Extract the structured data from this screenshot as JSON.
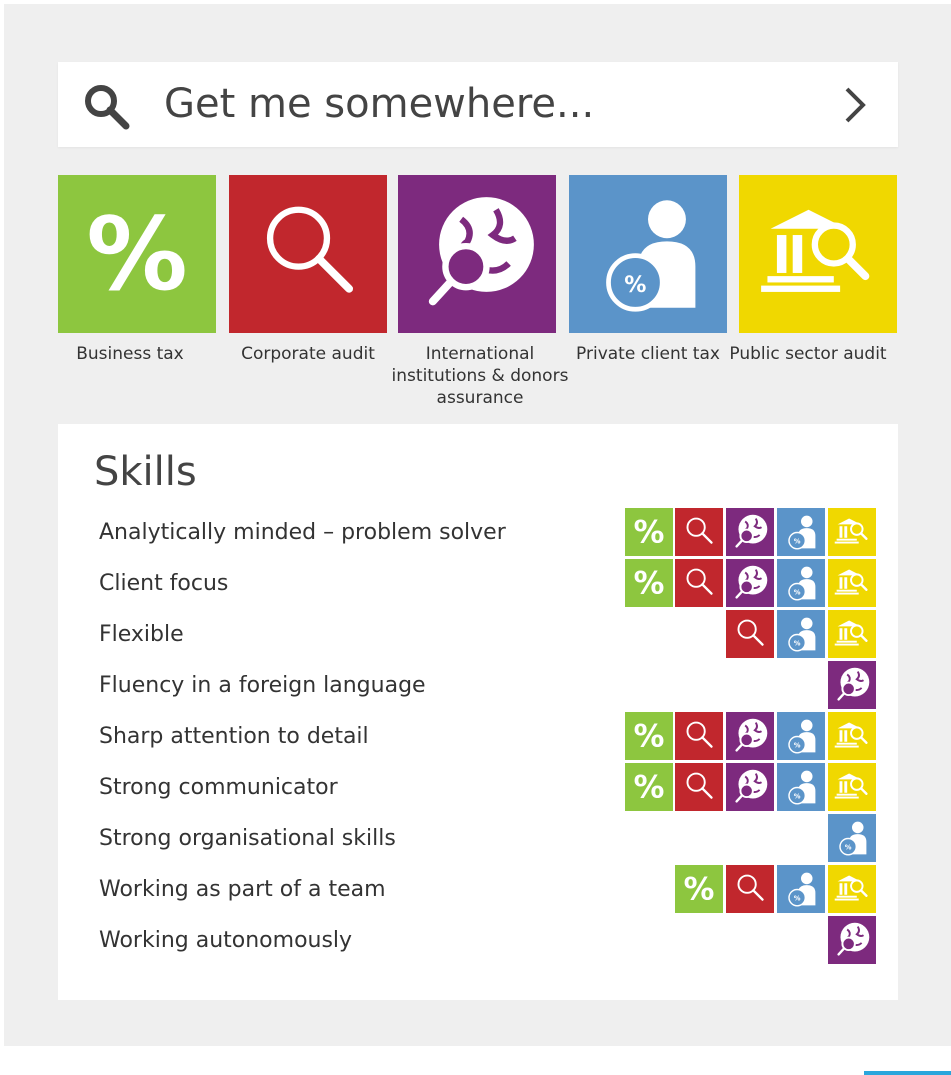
{
  "colors": {
    "background": "#efefef",
    "card": "#ffffff",
    "accent_blue": "#2aa6dc",
    "green": "#8dc63f",
    "red": "#c1272d",
    "purple": "#7d2a7e",
    "blue": "#5b94c9",
    "yellow": "#f0d800"
  },
  "search": {
    "text": "Get me somewhere...",
    "icon": "search-icon",
    "submit_icon": "chevron-right-icon"
  },
  "categories": [
    {
      "key": "business_tax",
      "label": "Business tax",
      "color": "#8dc63f",
      "icon": "percent-icon"
    },
    {
      "key": "corporate_audit",
      "label": "Corporate audit",
      "color": "#c1272d",
      "icon": "magnifier-icon"
    },
    {
      "key": "international",
      "label": "International institutions & donors assurance",
      "color": "#7d2a7e",
      "icon": "globe-magnifier-icon"
    },
    {
      "key": "private_client",
      "label": "Private client tax",
      "color": "#5b94c9",
      "icon": "person-percent-icon"
    },
    {
      "key": "public_sector",
      "label": "Public sector audit",
      "color": "#f0d800",
      "icon": "building-magnifier-icon"
    }
  ],
  "skills": {
    "title": "Skills",
    "items": [
      {
        "name": "Analytically minded – problem solver",
        "categories": [
          "business_tax",
          "corporate_audit",
          "international",
          "private_client",
          "public_sector"
        ]
      },
      {
        "name": "Client focus",
        "categories": [
          "business_tax",
          "corporate_audit",
          "international",
          "private_client",
          "public_sector"
        ]
      },
      {
        "name": "Flexible",
        "categories": [
          "corporate_audit",
          "private_client",
          "public_sector"
        ]
      },
      {
        "name": "Fluency in a foreign language",
        "categories": [
          "international"
        ]
      },
      {
        "name": "Sharp attention to detail",
        "categories": [
          "business_tax",
          "corporate_audit",
          "international",
          "private_client",
          "public_sector"
        ]
      },
      {
        "name": "Strong communicator",
        "categories": [
          "business_tax",
          "corporate_audit",
          "international",
          "private_client",
          "public_sector"
        ]
      },
      {
        "name": "Strong organisational skills",
        "categories": [
          "private_client"
        ]
      },
      {
        "name": "Working as part of a team",
        "categories": [
          "business_tax",
          "corporate_audit",
          "private_client",
          "public_sector"
        ]
      },
      {
        "name": "Working autonomously",
        "categories": [
          "international"
        ]
      }
    ]
  }
}
